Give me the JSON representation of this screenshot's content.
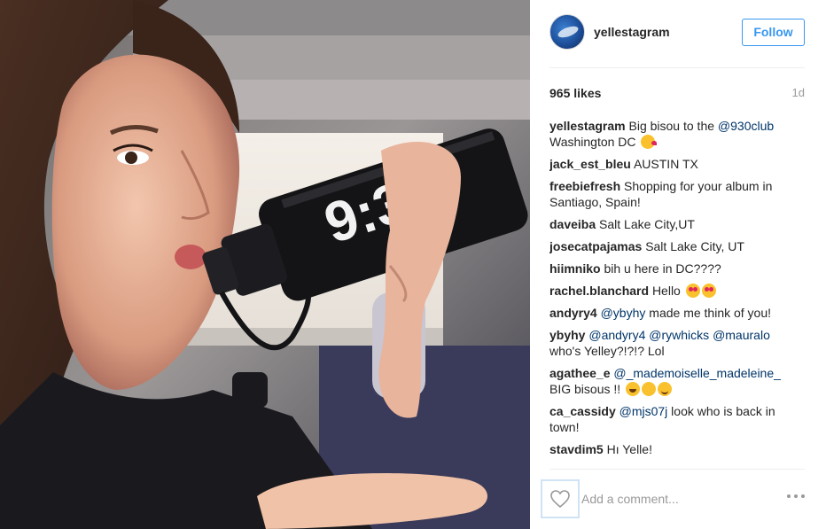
{
  "post": {
    "username": "yellestagram",
    "follow_label": "Follow",
    "likes": "965 likes",
    "time": "1d",
    "photo_bottle_text": "9:30"
  },
  "comments": [
    {
      "user": "yellestagram",
      "parts": [
        {
          "t": "Big bisou to the "
        },
        {
          "m": "@930club"
        },
        {
          "t": " Washington DC "
        }
      ],
      "emoji": [
        "kiss"
      ]
    },
    {
      "user": "jack_est_bleu",
      "parts": [
        {
          "t": "AUSTIN TX"
        }
      ],
      "emoji": []
    },
    {
      "user": "freebiefresh",
      "parts": [
        {
          "t": "Shopping for your album in Santiago, Spain!"
        }
      ],
      "emoji": []
    },
    {
      "user": "daveiba",
      "parts": [
        {
          "t": "Salt Lake City,UT"
        }
      ],
      "emoji": []
    },
    {
      "user": "josecatpajamas",
      "parts": [
        {
          "t": "Salt Lake City, UT"
        }
      ],
      "emoji": []
    },
    {
      "user": "hiimniko",
      "parts": [
        {
          "t": "bih u here in DC????"
        }
      ],
      "emoji": []
    },
    {
      "user": "rachel.blanchard",
      "parts": [
        {
          "t": "Hello "
        }
      ],
      "emoji": [
        "hearteyes",
        "hearteyes"
      ]
    },
    {
      "user": "andyry4",
      "parts": [
        {
          "m": "@ybyhy"
        },
        {
          "t": " made me think of you!"
        }
      ],
      "emoji": []
    },
    {
      "user": "ybyhy",
      "parts": [
        {
          "m": "@andyry4"
        },
        {
          "t": " "
        },
        {
          "m": "@rywhicks"
        },
        {
          "t": " "
        },
        {
          "m": "@mauralo"
        },
        {
          "t": " who's Yelley?!?!? Lol"
        }
      ],
      "emoji": []
    },
    {
      "user": "agathee_e",
      "parts": [
        {
          "m": "@_mademoiselle_madeleine_"
        },
        {
          "t": " BIG bisous !! "
        }
      ],
      "emoji": [
        "laugh",
        "smirk",
        "smile"
      ]
    },
    {
      "user": "ca_cassidy",
      "parts": [
        {
          "m": "@mjs07j"
        },
        {
          "t": " look who is back in town!"
        }
      ],
      "emoji": []
    },
    {
      "user": "stavdim5",
      "parts": [
        {
          "t": "Hı Yelle!"
        }
      ],
      "emoji": []
    },
    {
      "user": "",
      "parts": [
        {
          "t": ""
        }
      ],
      "emoji": []
    }
  ],
  "footer": {
    "comment_placeholder": "Add a comment..."
  },
  "icons": {
    "like": "heart-outline-icon",
    "more": "more-options-icon"
  }
}
